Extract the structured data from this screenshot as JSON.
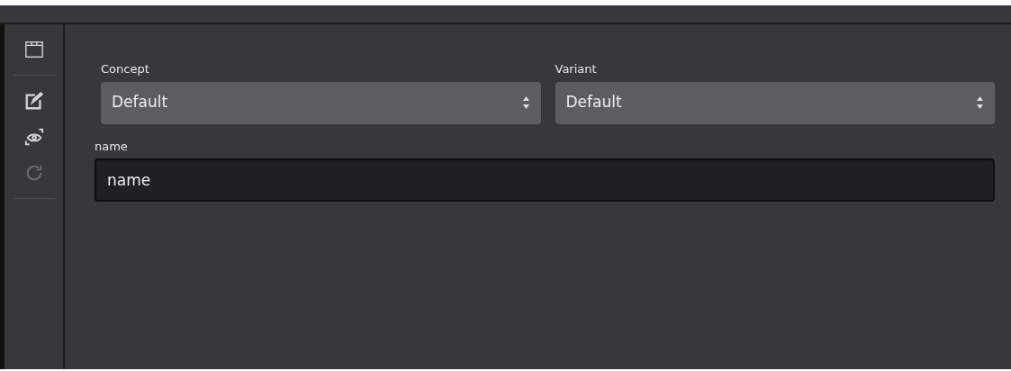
{
  "sidebar": {
    "items": [
      {
        "kind": "window",
        "disabled": false
      },
      {
        "kind": "divider"
      },
      {
        "kind": "edit",
        "disabled": false
      },
      {
        "kind": "preview",
        "disabled": false
      },
      {
        "kind": "refresh",
        "disabled": true
      },
      {
        "kind": "divider"
      }
    ]
  },
  "selects": [
    {
      "label": "Concept",
      "value": "Default"
    },
    {
      "label": "Variant",
      "value": "Default"
    }
  ],
  "field": {
    "label": "name",
    "value": "name"
  }
}
